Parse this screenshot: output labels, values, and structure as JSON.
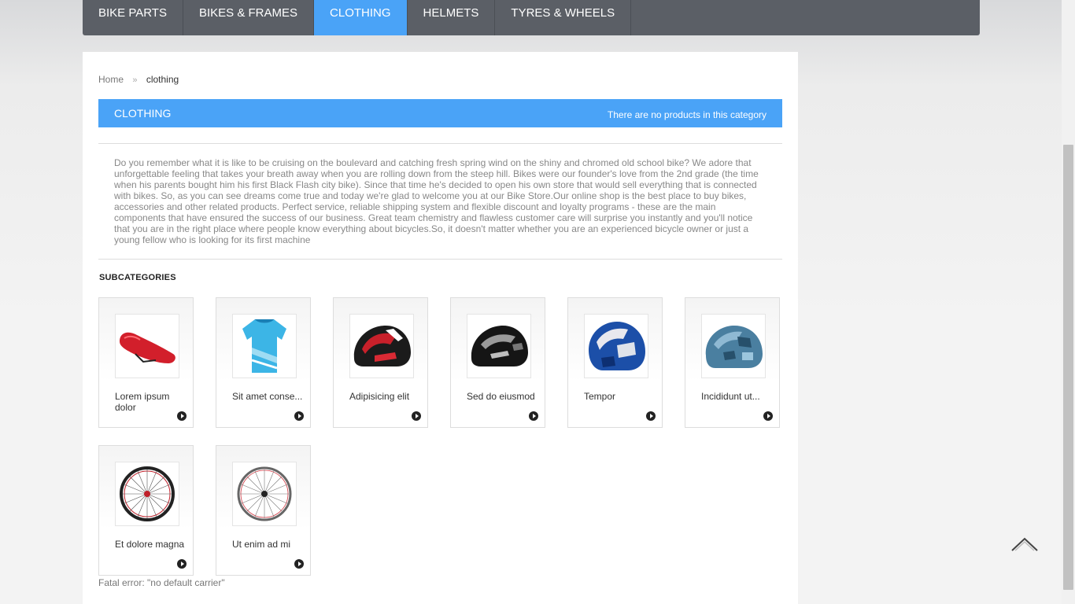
{
  "nav": {
    "items": [
      {
        "label": "BIKE PARTS"
      },
      {
        "label": "BIKES & FRAMES"
      },
      {
        "label": "CLOTHING"
      },
      {
        "label": "HELMETS"
      },
      {
        "label": "TYRES & WHEELS"
      }
    ],
    "active": "CLOTHING"
  },
  "breadcrumb": {
    "home": "Home",
    "separator": "»",
    "current": "clothing"
  },
  "category": {
    "title": "CLOTHING",
    "products_note": "There are no products in this category",
    "description": "Do you remember what it is like to be cruising on the boulevard and catching fresh spring wind on the shiny and chromed old school bike? We adore that unforgettable feeling that takes your breath away when you are rolling down from the steep hill. Bikes were our founder's love from the 2nd grade (the time when his parents bought him his first Black Flash city bike). Since that time he's decided to open his own store that would sell everything that is connected with bikes. So, as you can see dreams come true and today we're glad to welcome you at our Bike Store.Our online shop is the best place to buy bikes, accessories and other related products. Perfect service, reliable shipping system and flexible discount and loyalty programs - these are the main components that have ensured the success of our business. Great team chemistry and flawless customer care will surprise you instantly and you'll notice that you are in the right place where people know everything about bicycles.So, it doesn't matter whether you are an experienced bicycle owner or just a young fellow who is looking for its first machine"
  },
  "subcategories": {
    "title": "SUBCATEGORIES",
    "items": [
      {
        "name": "Lorem ipsum dolor",
        "icon": "bike-saddle-icon"
      },
      {
        "name": "Sit amet conse...",
        "icon": "cycling-jersey-icon"
      },
      {
        "name": "Adipisicing elit",
        "icon": "helmet-icon"
      },
      {
        "name": "Sed do eiusmod",
        "icon": "helmet-icon"
      },
      {
        "name": "Tempor",
        "icon": "helmet-icon"
      },
      {
        "name": "Incididunt ut...",
        "icon": "helmet-icon"
      },
      {
        "name": "Et dolore magna",
        "icon": "wheel-icon"
      },
      {
        "name": "Ut enim ad mi",
        "icon": "wheel-icon"
      }
    ]
  },
  "error": "Fatal error: \"no default carrier\"",
  "colors": {
    "accent": "#4aa3f7",
    "nav_bg": "#5b5f66"
  }
}
